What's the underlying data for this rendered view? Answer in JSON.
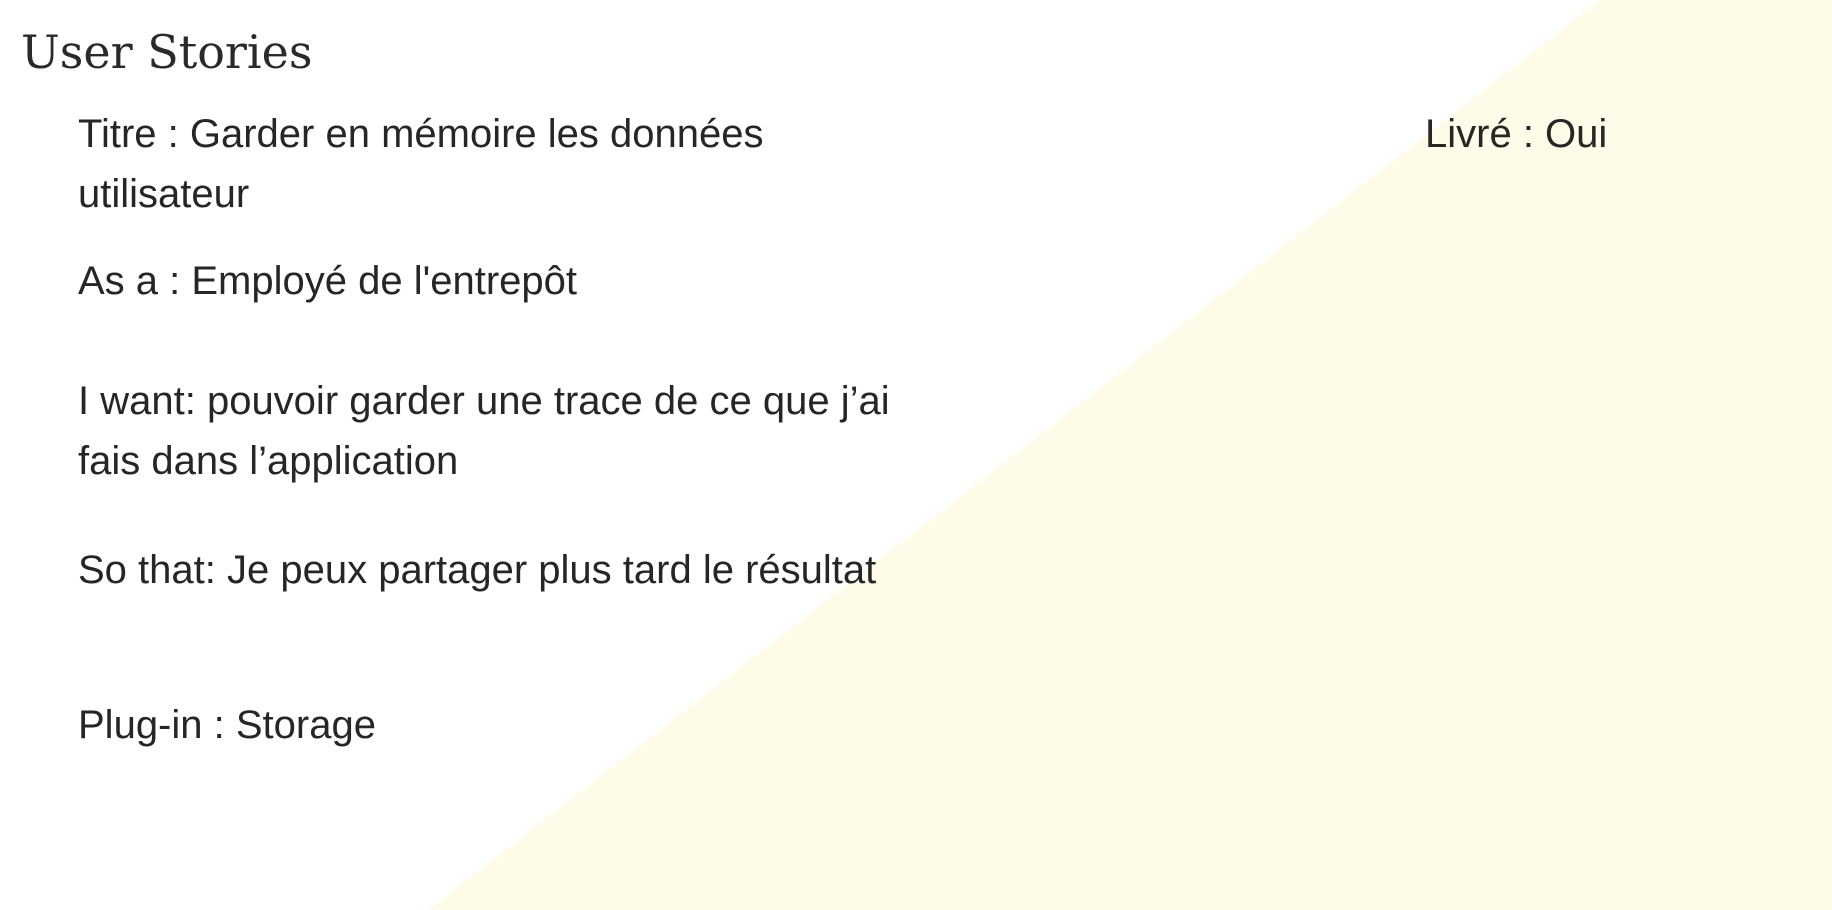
{
  "slide": {
    "title": "User Stories",
    "accent_color": "#fefbe9",
    "background_color": "#ffffff",
    "text_color": "#262626",
    "fields": {
      "titre": "Titre : Garder en mémoire les  données utilisateur",
      "as_a": "As a : Employé de l'entrepôt",
      "i_want": "I want: pouvoir garder une trace de ce que j’ai fais dans l’application",
      "so_that": "So that: Je peux partager plus tard le résultat",
      "plugin": "Plug-in : Storage",
      "livre": "Livré : Oui"
    }
  }
}
